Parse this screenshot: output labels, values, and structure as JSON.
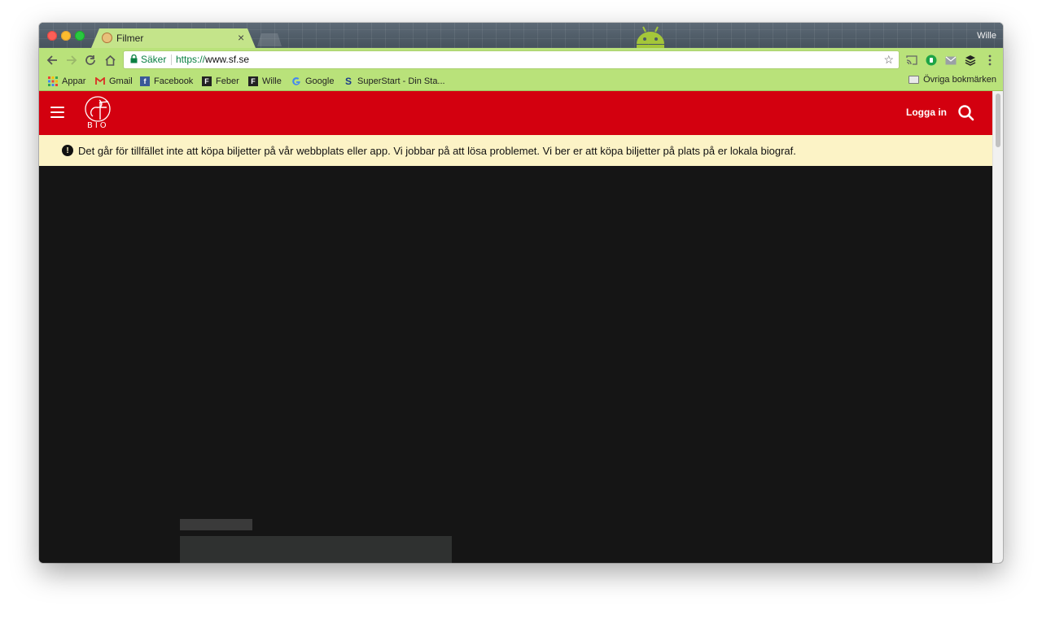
{
  "browser": {
    "profile_name": "Wille",
    "tab": {
      "title": "Filmer",
      "close_glyph": "×"
    },
    "omnibox": {
      "secure_label": "Säker",
      "url_scheme": "https://",
      "url_host": "www.sf.se"
    },
    "bookmarks": [
      {
        "label": "Appar",
        "icon": "apps-grid-icon"
      },
      {
        "label": "Gmail",
        "icon": "gmail-icon"
      },
      {
        "label": "Facebook",
        "icon": "facebook-icon"
      },
      {
        "label": "Feber",
        "icon": "feber-icon"
      },
      {
        "label": "Wille",
        "icon": "feber-icon"
      },
      {
        "label": "Google",
        "icon": "google-icon"
      },
      {
        "label": "SuperStart - Din Sta...",
        "icon": "superstart-icon"
      }
    ],
    "other_bookmarks_label": "Övriga bokmärken",
    "colors": {
      "toolbar": "#b9e27a",
      "tab": "#c4e48a"
    }
  },
  "site": {
    "header": {
      "logo_text": "BIO",
      "login_label": "Logga in"
    },
    "notice": {
      "icon_glyph": "!",
      "text": "Det går för tillfället inte att köpa biljetter på vår webbplats eller app. Vi jobbar på att lösa problemet. Vi ber er att köpa biljetter på plats på er lokala biograf."
    },
    "colors": {
      "brand_red": "#d3000f",
      "notice_bg": "#fcf3c6",
      "page_bg": "#151515"
    }
  }
}
